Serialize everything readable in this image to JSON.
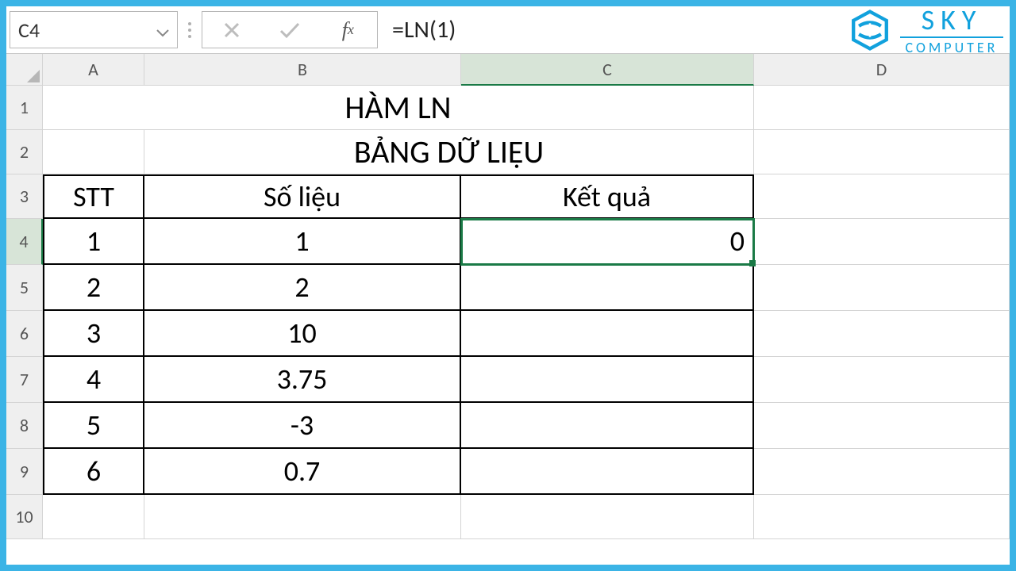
{
  "formula_bar": {
    "cell_ref": "C4",
    "formula": "=LN(1)"
  },
  "logo": {
    "line1": "SKY",
    "line2": "COMPUTER"
  },
  "columns": [
    "A",
    "B",
    "C",
    "D"
  ],
  "row_heads": [
    "1",
    "2",
    "3",
    "4",
    "5",
    "6",
    "7",
    "8",
    "9",
    "10"
  ],
  "title": "HÀM LN",
  "subtitle": "BẢNG DỮ LIỆU",
  "headers": {
    "a": "STT",
    "b": "Số liệu",
    "c": "Kết quả"
  },
  "rows": [
    {
      "stt": "1",
      "solieu": "1",
      "ketqua": "0"
    },
    {
      "stt": "2",
      "solieu": "2",
      "ketqua": ""
    },
    {
      "stt": "3",
      "solieu": "10",
      "ketqua": ""
    },
    {
      "stt": "4",
      "solieu": "3.75",
      "ketqua": ""
    },
    {
      "stt": "5",
      "solieu": "-3",
      "ketqua": ""
    },
    {
      "stt": "6",
      "solieu": "0.7",
      "ketqua": ""
    }
  ],
  "selected_cell": "C4"
}
